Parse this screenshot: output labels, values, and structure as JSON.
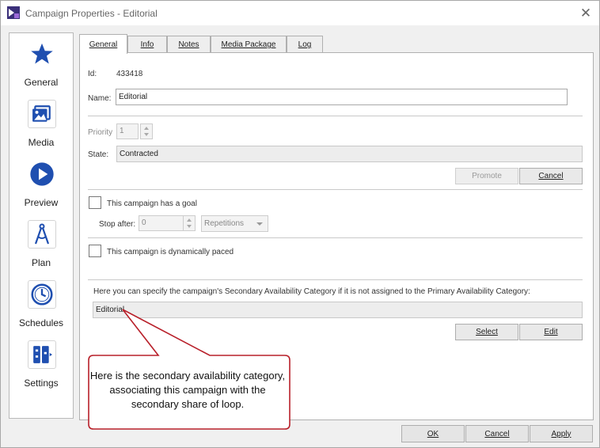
{
  "window": {
    "title": "Campaign Properties - Editorial",
    "close_glyph": "✕"
  },
  "nav": [
    {
      "label": "General",
      "icon": "star-icon"
    },
    {
      "label": "Media",
      "icon": "media-icon"
    },
    {
      "label": "Preview",
      "icon": "play-icon"
    },
    {
      "label": "Plan",
      "icon": "compass-icon"
    },
    {
      "label": "Schedules",
      "icon": "clock-icon"
    },
    {
      "label": "Settings",
      "icon": "settings-icon"
    }
  ],
  "tabs": [
    {
      "label": "General",
      "active": true
    },
    {
      "label": "Info"
    },
    {
      "label": "Notes"
    },
    {
      "label": "Media Package"
    },
    {
      "label": "Log"
    }
  ],
  "general": {
    "id_label": "Id:",
    "id_value": "433418",
    "name_label": "Name:",
    "name_value": "Editorial",
    "priority_label": "Priority",
    "priority_value": "1",
    "state_label": "State:",
    "state_value": "Contracted",
    "promote_label": "Promote",
    "cancel_label": "Cancel",
    "goal_checkbox_label": "This campaign has a goal",
    "stop_after_label": "Stop after:",
    "stop_after_value": "0",
    "repetitions_value": "Repetitions",
    "dynamic_checkbox_label": "This campaign is dynamically paced",
    "secondary_desc": "Here you can specify the campaign's Secondary Availability Category if it is not assigned to the Primary Availability Category:",
    "secondary_value": "Editorial",
    "select_label": "Select",
    "edit_label": "Edit"
  },
  "footer": {
    "ok_label": "OK",
    "cancel_label": "Cancel",
    "apply_label": "Apply"
  },
  "callout": {
    "text": "Here is the secondary availability category, associating this campaign with the secondary share of loop.",
    "border_color": "#b8202a"
  },
  "colors": {
    "icon_blue": "#1f4fb0",
    "accent_purple": "#6a3fa0"
  }
}
